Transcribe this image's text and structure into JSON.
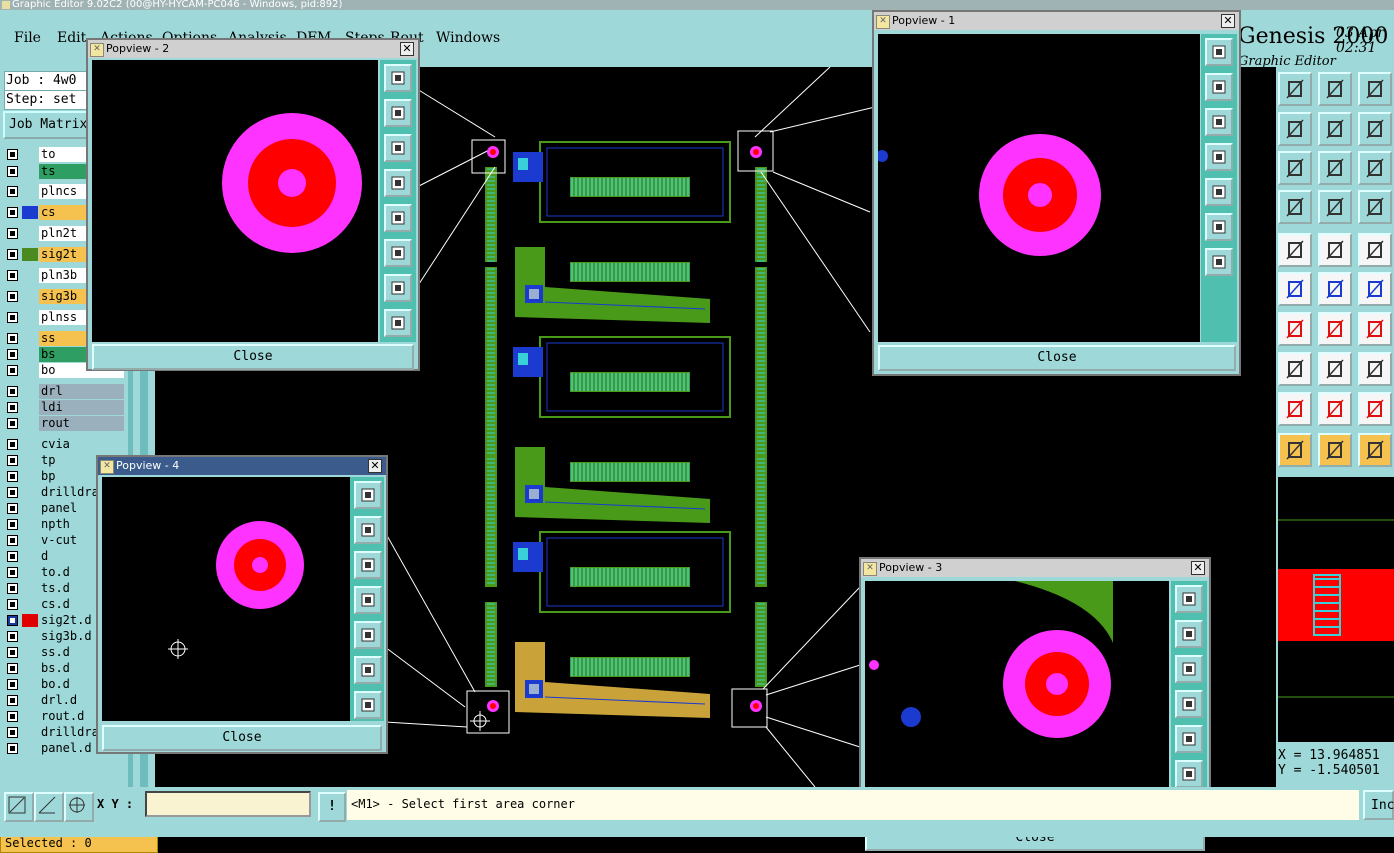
{
  "window": {
    "title": "Graphic Editor 9.02C2 (00@HY-HYCAM-PC046 - Windows, pid:892)"
  },
  "menu": [
    "File",
    "Edit",
    "Actions",
    "Options",
    "Analysis",
    "DFM",
    "Steps",
    "Rout",
    "Windows"
  ],
  "brand": {
    "name": "Genesis 2000",
    "subtitle": "Graphic Editor",
    "date": "03 Apr",
    "time": "02:31"
  },
  "job": {
    "job_line": "Job : 4w0",
    "step_line": "Step: set",
    "matrix_button": "Job Matrix"
  },
  "layers": [
    {
      "name": "to",
      "color": "#ffffff"
    },
    {
      "name": "ts",
      "color": "#2e9e62"
    },
    {
      "name": "plncs",
      "color": "#ffffff"
    },
    {
      "name": "cs",
      "color": "#f6c24f",
      "swatch": "#1a3ad0"
    },
    {
      "name": "pln2t",
      "color": "#ffffff"
    },
    {
      "name": "sig2t",
      "color": "#f6c24f",
      "swatch": "#4a8a20"
    },
    {
      "name": "pln3b",
      "color": "#ffffff"
    },
    {
      "name": "sig3b",
      "color": "#f6c24f"
    },
    {
      "name": "plnss",
      "color": "#ffffff"
    },
    {
      "name": "ss",
      "color": "#f6c24f"
    },
    {
      "name": "bs",
      "color": "#2e9e62"
    },
    {
      "name": "bo",
      "color": "#ffffff"
    },
    {
      "name": "drl",
      "color": "#9ab0bc"
    },
    {
      "name": "ldi",
      "color": "#9ab0bc"
    },
    {
      "name": "rout",
      "color": "#9ab0bc"
    },
    {
      "name": "cvia",
      "color": "#9fd8d8"
    },
    {
      "name": "tp",
      "color": "#9fd8d8"
    },
    {
      "name": "bp",
      "color": "#9fd8d8"
    },
    {
      "name": "drilldraw",
      "color": "#9fd8d8"
    },
    {
      "name": "panel",
      "color": "#9fd8d8"
    },
    {
      "name": "npth",
      "color": "#9fd8d8"
    },
    {
      "name": "v-cut",
      "color": "#9fd8d8"
    },
    {
      "name": "d",
      "color": "#9fd8d8"
    },
    {
      "name": "to.d",
      "color": "#9fd8d8"
    },
    {
      "name": "ts.d",
      "color": "#9fd8d8"
    },
    {
      "name": "cs.d",
      "color": "#9fd8d8"
    },
    {
      "name": "sig2t.d",
      "color": "#9fd8d8",
      "swatch": "#e00000",
      "selected": true
    },
    {
      "name": "sig3b.d",
      "color": "#9fd8d8"
    },
    {
      "name": "ss.d",
      "color": "#9fd8d8"
    },
    {
      "name": "bs.d",
      "color": "#9fd8d8"
    },
    {
      "name": "bo.d",
      "color": "#9fd8d8"
    },
    {
      "name": "drl.d",
      "color": "#9fd8d8"
    },
    {
      "name": "rout.d",
      "color": "#9fd8d8"
    },
    {
      "name": "drilldraw.d",
      "color": "#9fd8d8"
    },
    {
      "name": "panel.d",
      "color": "#9fd8d8"
    }
  ],
  "selected_label": "Selected : 0",
  "status": {
    "xy_label": "X Y :",
    "xy_value": "",
    "warn": "!",
    "prompt": "<M1> - Select first area corner",
    "inc_button": "Inc"
  },
  "coords": {
    "x": "X = 13.964851",
    "y": "Y = -1.540501"
  },
  "popviews": [
    {
      "title": "Popview - 1",
      "close": "Close"
    },
    {
      "title": "Popview - 2",
      "close": "Close"
    },
    {
      "title": "Popview - 3",
      "close": "Close"
    },
    {
      "title": "Popview - 4",
      "close": "Close"
    }
  ],
  "colors": {
    "panel": "#9fd8d8",
    "pad_outer": "#ff33ff",
    "pad_inner": "#ff0000",
    "copper_green": "#4a9a1a",
    "signal_blue": "#1a3ad0",
    "gold": "#c9a23a"
  }
}
